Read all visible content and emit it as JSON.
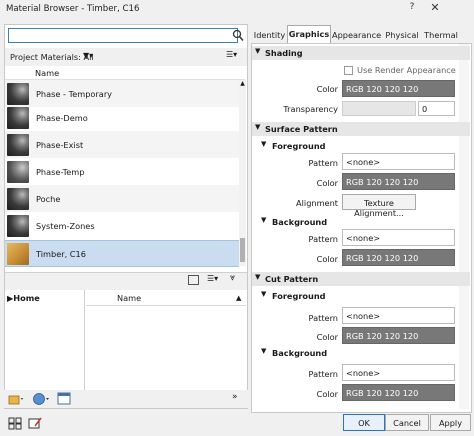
{
  "window": {
    "title": "Material Browser - Timber, C16",
    "help_glyph": "?",
    "close_glyph": "✕"
  },
  "browser": {
    "search_value": "",
    "project_materials_label": "Project Materials: All",
    "name_column": "Name",
    "materials": [
      {
        "name": "Phase - Temporary",
        "thumb": "dark"
      },
      {
        "name": "Phase-Demo",
        "thumb": "dark"
      },
      {
        "name": "Phase-Exist",
        "thumb": "dark"
      },
      {
        "name": "Phase-Temp",
        "thumb": "mid"
      },
      {
        "name": "Poche",
        "thumb": "dark"
      },
      {
        "name": "System-Zones",
        "thumb": "dark"
      },
      {
        "name": "Timber, C16",
        "thumb": "wood",
        "selected": true
      }
    ],
    "library": {
      "tree_root": "Home",
      "name_column": "Name"
    }
  },
  "tabs": [
    "Identity",
    "Graphics",
    "Appearance",
    "Physical",
    "Thermal"
  ],
  "active_tab": "Graphics",
  "graphics": {
    "shading": {
      "title": "Shading",
      "use_render_label": "Use Render Appearance",
      "use_render_checked": false,
      "color_label": "Color",
      "color_value": "RGB 120 120 120",
      "transparency_label": "Transparency",
      "transparency_value": "0"
    },
    "surface_pattern": {
      "title": "Surface Pattern",
      "foreground": {
        "title": "Foreground",
        "pattern_label": "Pattern",
        "pattern_value": "<none>",
        "color_label": "Color",
        "color_value": "RGB 120 120 120",
        "alignment_label": "Alignment",
        "alignment_button": "Texture Alignment..."
      },
      "background": {
        "title": "Background",
        "pattern_label": "Pattern",
        "pattern_value": "<none>",
        "color_label": "Color",
        "color_value": "RGB 120 120 120"
      }
    },
    "cut_pattern": {
      "title": "Cut Pattern",
      "foreground": {
        "title": "Foreground",
        "pattern_label": "Pattern",
        "pattern_value": "<none>",
        "color_label": "Color",
        "color_value": "RGB 120 120 120"
      },
      "background": {
        "title": "Background",
        "pattern_label": "Pattern",
        "pattern_value": "<none>",
        "color_label": "Color",
        "color_value": "RGB 120 120 120"
      }
    }
  },
  "buttons": {
    "ok": "OK",
    "cancel": "Cancel",
    "apply": "Apply"
  },
  "colors": {
    "selection": "#c9dcf0",
    "swatch_gray": "#787878",
    "section_header": "#e6e6e6"
  }
}
